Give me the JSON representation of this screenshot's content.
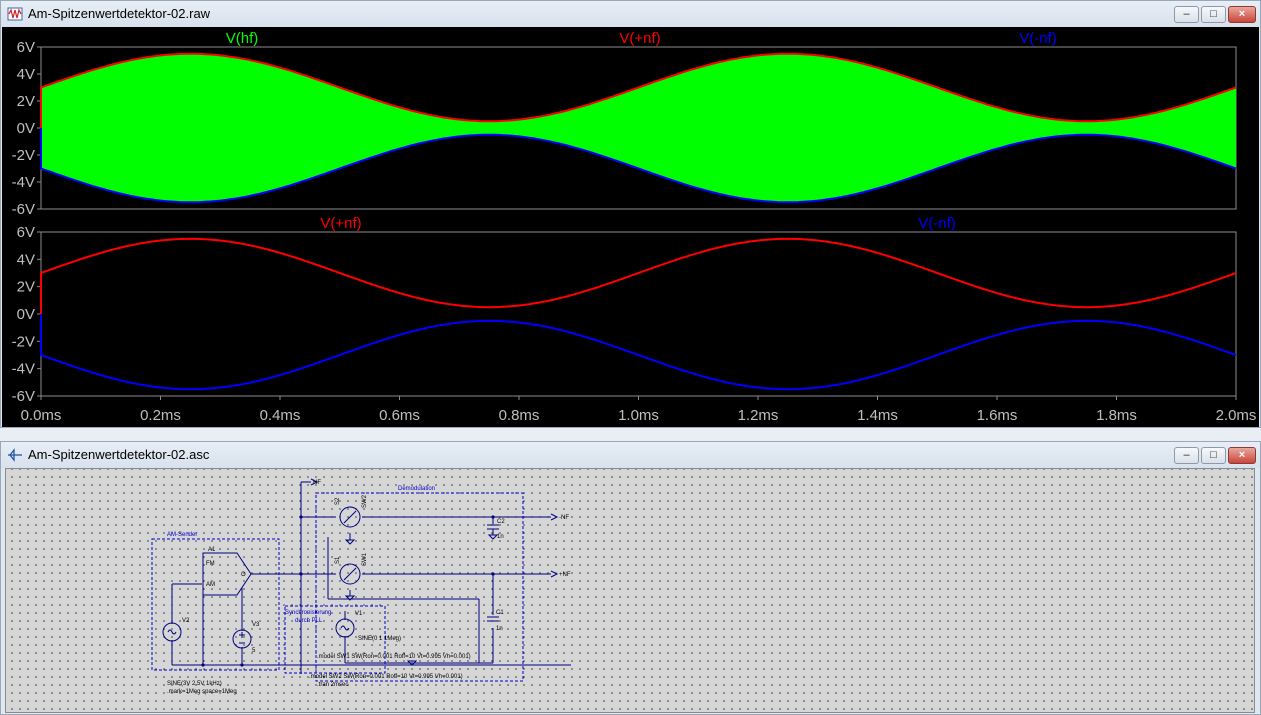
{
  "plot_window": {
    "title": "Am-Spitzenwertdetektor-02.raw",
    "buttons": {
      "minimize": "–",
      "restore": "□",
      "close": "×"
    },
    "top_pane": {
      "traces": [
        "V(hf)",
        "V(+nf)",
        "V(-nf)"
      ],
      "colors": [
        "#00ff00",
        "#ff0000",
        "#0000ff"
      ]
    },
    "bottom_pane": {
      "traces": [
        "V(+nf)",
        "V(-nf)"
      ],
      "colors": [
        "#ff0000",
        "#0000ff"
      ]
    },
    "y_ticks": [
      "6V",
      "4V",
      "2V",
      "0V",
      "-2V",
      "-4V",
      "-6V"
    ],
    "x_ticks": [
      "0.0ms",
      "0.2ms",
      "0.4ms",
      "0.6ms",
      "0.8ms",
      "1.0ms",
      "1.2ms",
      "1.4ms",
      "1.6ms",
      "1.8ms",
      "2.0ms"
    ]
  },
  "schematic_window": {
    "title": "Am-Spitzenwertdetektor-02.asc",
    "buttons": {
      "minimize": "–",
      "restore": "□",
      "close": "×"
    },
    "labels": {
      "hf": "HF",
      "demodulation": "Demodulation",
      "am_sender": "AM-Sender",
      "a1": "A1",
      "fm": "FM",
      "am": "AM",
      "o": "O",
      "v2": "V2",
      "v3": "V3",
      "v3_val": "5",
      "v1": "V1",
      "c1": "C1",
      "c1_val": "1n",
      "c2": "C2",
      "c2_val": "1n",
      "s1": "S1",
      "s1_model": "SW1",
      "s2": "S2",
      "s2_model": "SW2",
      "nf_plus": "+NF",
      "nf_minus": "-NF",
      "sync_1": "Synchronisierung",
      "sync_2": "durch PLL",
      "v1_sine": "SINE(0 1 1Meg)",
      "model1": ".model SW1 SW(Ron=0.001 Roff=10 Vt=0.995 Vh=0.001)",
      "model2": ".model SW2 SW(Ron=0.001 Roff=10 Vt=0.995 Vh=0.001)",
      "tran": ".tran 2msec",
      "v2_sine": "SINE(3V 2.5V 1kHz)",
      "mark": ".mark=1Meg space=1Meg"
    }
  },
  "chart_data": [
    {
      "type": "line",
      "title": "",
      "xlabel": "",
      "ylabel": "",
      "xlim": [
        0,
        2.0
      ],
      "ylim": [
        -6,
        6
      ],
      "grid": false,
      "series": [
        {
          "name": "V(hf)",
          "color": "#00ff00",
          "description": "AM carrier fill between envelopes",
          "fill_between": [
            "V(+nf)",
            "V(-nf)"
          ]
        },
        {
          "name": "V(+nf)",
          "color": "#ff0000",
          "x": [
            0.0,
            0.1,
            0.25,
            0.4,
            0.5,
            0.6,
            0.75,
            0.9,
            1.0,
            1.1,
            1.25,
            1.4,
            1.5,
            1.6,
            1.75,
            1.9,
            2.0
          ],
          "y": [
            3.0,
            4.5,
            5.5,
            4.5,
            3.0,
            1.5,
            0.5,
            1.5,
            3.0,
            4.5,
            5.5,
            4.5,
            3.0,
            1.5,
            0.5,
            1.5,
            3.0
          ]
        },
        {
          "name": "V(-nf)",
          "color": "#0000ff",
          "x": [
            0.0,
            0.1,
            0.25,
            0.4,
            0.5,
            0.6,
            0.75,
            0.9,
            1.0,
            1.1,
            1.25,
            1.4,
            1.5,
            1.6,
            1.75,
            1.9,
            2.0
          ],
          "y": [
            -3.0,
            -4.5,
            -5.5,
            -4.5,
            -3.0,
            -1.5,
            -0.5,
            -1.5,
            -3.0,
            -4.5,
            -5.5,
            -4.5,
            -3.0,
            -1.5,
            -0.5,
            -1.5,
            -3.0
          ]
        }
      ]
    },
    {
      "type": "line",
      "title": "",
      "xlabel": "",
      "ylabel": "",
      "xlim": [
        0,
        2.0
      ],
      "ylim": [
        -6,
        6
      ],
      "grid": false,
      "series": [
        {
          "name": "V(+nf)",
          "color": "#ff0000",
          "x": [
            0.0,
            0.1,
            0.25,
            0.4,
            0.5,
            0.6,
            0.75,
            0.9,
            1.0,
            1.1,
            1.25,
            1.4,
            1.5,
            1.6,
            1.75,
            1.9,
            2.0
          ],
          "y": [
            3.0,
            4.5,
            5.5,
            4.5,
            3.0,
            1.5,
            0.5,
            1.5,
            3.0,
            4.5,
            5.5,
            4.5,
            3.0,
            1.5,
            0.5,
            1.5,
            3.0
          ]
        },
        {
          "name": "V(-nf)",
          "color": "#0000ff",
          "x": [
            0.0,
            0.1,
            0.25,
            0.4,
            0.5,
            0.6,
            0.75,
            0.9,
            1.0,
            1.1,
            1.25,
            1.4,
            1.5,
            1.6,
            1.75,
            1.9,
            2.0
          ],
          "y": [
            -3.0,
            -4.5,
            -5.5,
            -4.5,
            -3.0,
            -1.5,
            -0.5,
            -1.5,
            -3.0,
            -4.5,
            -5.5,
            -4.5,
            -3.0,
            -1.5,
            -0.5,
            -1.5,
            -3.0
          ]
        }
      ]
    }
  ]
}
